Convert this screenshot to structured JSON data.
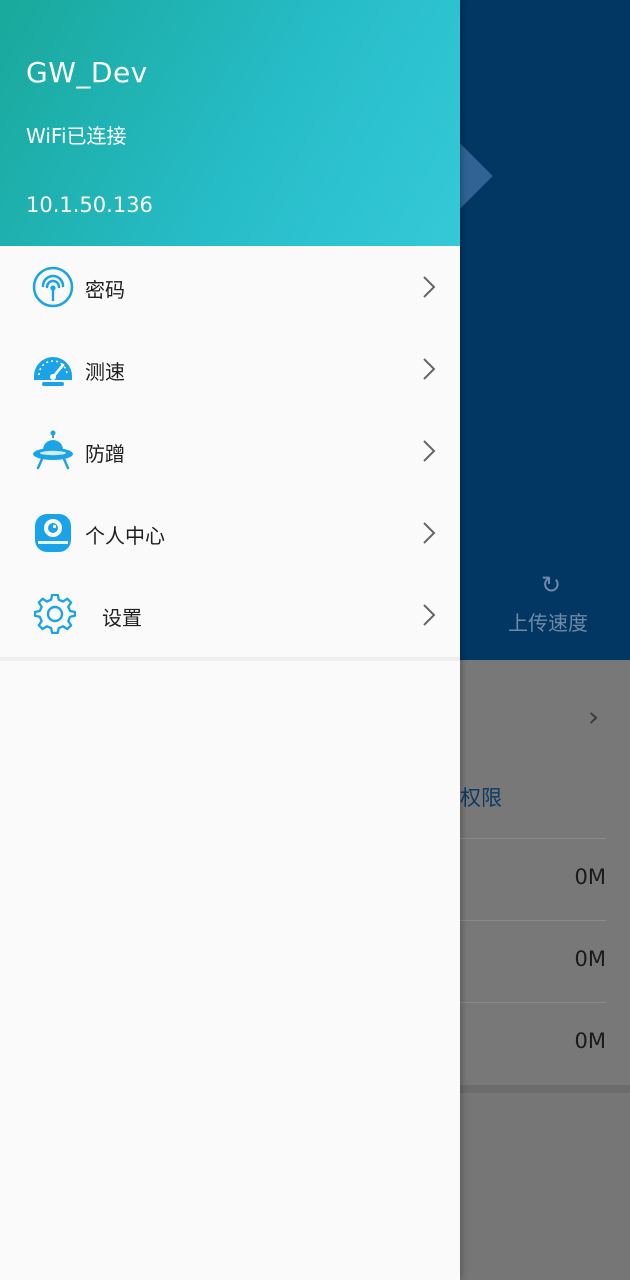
{
  "header": {
    "ssid": "GW_Dev",
    "status": "WiFi已连接",
    "ip": "10.1.50.136"
  },
  "menu": {
    "items": [
      {
        "label": "密码",
        "icon": "wifi-signal-icon"
      },
      {
        "label": "测速",
        "icon": "speedometer-icon"
      },
      {
        "label": "防蹭",
        "icon": "ufo-icon"
      },
      {
        "label": "个人中心",
        "icon": "camera-profile-icon"
      },
      {
        "label": "设置",
        "icon": "gear-icon"
      }
    ]
  },
  "background": {
    "upload_label": "上传速度",
    "permission_label": "权限",
    "rows": [
      "0M",
      "0M",
      "0M"
    ]
  },
  "colors": {
    "header_start": "#19a89b",
    "header_end": "#35c9d8",
    "icon_blue": "#1aa3e8",
    "bg_top": "#023663"
  }
}
